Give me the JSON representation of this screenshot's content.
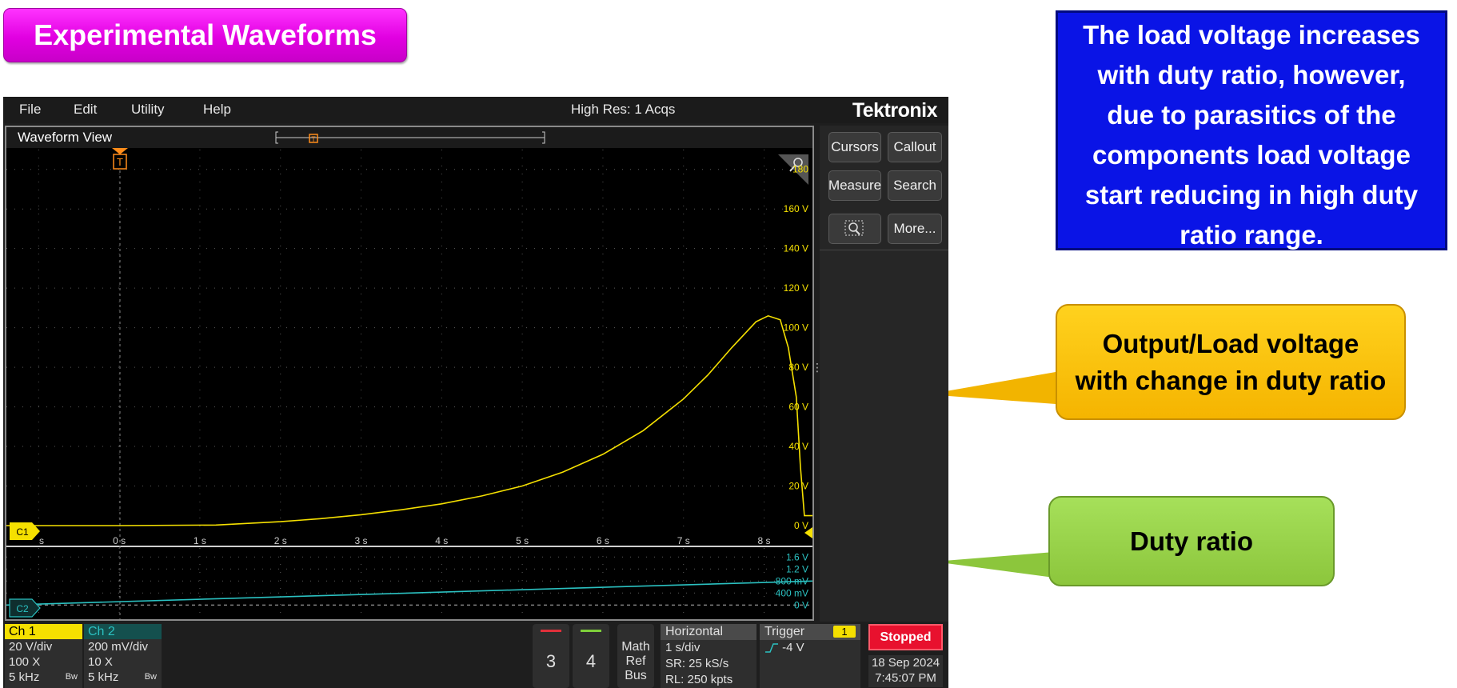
{
  "slide_title": "Experimental Waveforms",
  "note_lines": [
    "The load voltage increases",
    "with duty ratio, however,",
    "due to parasitics of the",
    "components load voltage",
    "start reducing in high duty",
    "ratio range."
  ],
  "callout_output": [
    "Output/Load voltage",
    "with change in duty ratio"
  ],
  "callout_duty": "Duty ratio",
  "scope": {
    "menu": [
      "File",
      "Edit",
      "Utility",
      "Help"
    ],
    "acq_status": "High Res: 1 Acqs",
    "brand": "Tektronix",
    "waveform_view_label": "Waveform View",
    "trigger_marker": "T",
    "side_buttons": [
      "Cursors",
      "Callout",
      "Measure",
      "Search",
      "More..."
    ],
    "ch1": {
      "name": "Ch 1",
      "vdiv": "20 V/div",
      "probe": "100 X",
      "bw": "5 kHz",
      "bw_tag": "Bw",
      "color": "#f5e000"
    },
    "ch2": {
      "name": "Ch 2",
      "vdiv": "200 mV/div",
      "probe": "10 X",
      "bw": "5 kHz",
      "bw_tag": "Bw",
      "color": "#2bc1c1"
    },
    "extra_channels": [
      "3",
      "4"
    ],
    "math_ref_bus": [
      "Math",
      "Ref",
      "Bus"
    ],
    "horizontal": {
      "title": "Horizontal",
      "scale": "1 s/div",
      "sample_rate": "SR: 25 kS/s",
      "record_length": "RL: 250 kpts"
    },
    "trigger": {
      "title": "Trigger",
      "channel": "1",
      "level": "-4 V"
    },
    "state": "Stopped",
    "date": "18 Sep 2024",
    "time": "7:45:07 PM"
  },
  "chart_data": [
    {
      "type": "line",
      "name": "C1",
      "x_tick_labels": [
        "s",
        "0 s",
        "1 s",
        "2 s",
        "3 s",
        "4 s",
        "5 s",
        "6 s",
        "7 s",
        "8 s"
      ],
      "y_tick_labels": [
        "0 V",
        "20 V",
        "40 V",
        "60 V",
        "80 V",
        "100 V",
        "120 V",
        "140 V",
        "160 V",
        "180"
      ],
      "xlim": [
        -1.4,
        8.6
      ],
      "ylim": [
        0,
        190
      ],
      "x": [
        -1.4,
        0,
        1.2,
        2,
        2.5,
        3,
        3.5,
        4,
        4.5,
        5,
        5.5,
        6,
        6.5,
        7,
        7.3,
        7.6,
        7.9,
        8.05,
        8.2,
        8.3,
        8.4,
        8.45,
        8.5,
        8.6
      ],
      "y": [
        0,
        0,
        0.3,
        2,
        3.5,
        5.5,
        8,
        11,
        15,
        20,
        27,
        36,
        48,
        64,
        76,
        90,
        103,
        106,
        104,
        90,
        65,
        30,
        5,
        5
      ]
    },
    {
      "type": "line",
      "name": "C2",
      "y_tick_labels": [
        "0 V",
        "400 mV",
        "800 mV",
        "1.2 V",
        "1.6 V"
      ],
      "xlim": [
        -1.4,
        8.6
      ],
      "ylim": [
        -0.1,
        1.9
      ],
      "x": [
        -1.4,
        8.6
      ],
      "y": [
        0.0,
        0.8
      ]
    }
  ]
}
